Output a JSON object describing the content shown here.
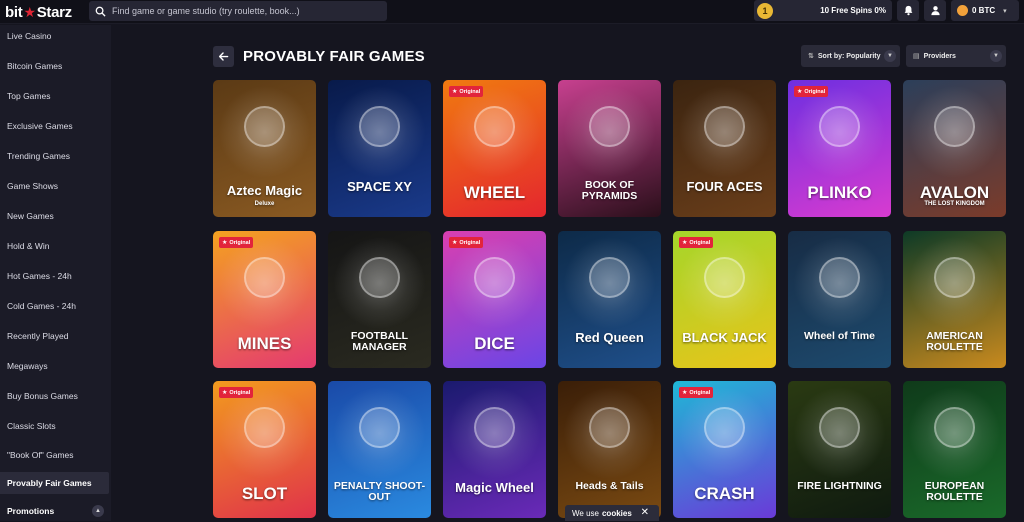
{
  "brand": {
    "logo_left": "bit",
    "logo_star": "★",
    "logo_right": "Starz"
  },
  "search": {
    "placeholder": "Find game or game studio (try roulette, book...)"
  },
  "header": {
    "free_spins_icon": "1",
    "free_spins": "10 Free Spins 0%",
    "balance": "0 BTC",
    "bell_icon": "bell-icon",
    "user_icon": "user-icon"
  },
  "sidebar": {
    "items": [
      {
        "label": "Live Casino"
      },
      {
        "label": "Bitcoin Games"
      },
      {
        "label": "Top Games"
      },
      {
        "label": "Exclusive Games"
      },
      {
        "label": "Trending Games"
      },
      {
        "label": "Game Shows"
      },
      {
        "label": "New Games"
      },
      {
        "label": "Hold & Win"
      },
      {
        "label": "Hot Games - 24h"
      },
      {
        "label": "Cold Games - 24h"
      },
      {
        "label": "Recently Played"
      },
      {
        "label": "Megaways"
      },
      {
        "label": "Buy Bonus Games"
      },
      {
        "label": "Classic Slots"
      },
      {
        "label": "\"Book Of\" Games"
      },
      {
        "label": "Provably Fair Games"
      }
    ],
    "active": "Provably Fair Games",
    "promotions": "Promotions"
  },
  "page": {
    "title": "PROVABLY FAIR GAMES",
    "sort_label": "Sort by: Popularity",
    "providers_label": "Providers"
  },
  "badge_label": "Original",
  "games": [
    {
      "title": "Aztec Magic",
      "subtitle": "Deluxe",
      "original": false,
      "bg": [
        "#5b3a15",
        "#8a5a22"
      ]
    },
    {
      "title": "SPACE XY",
      "original": false,
      "bg": [
        "#081a4a",
        "#1a3a8a"
      ]
    },
    {
      "title": "WHEEL",
      "original": true,
      "bg": [
        "#f07a10",
        "#e4262e"
      ]
    },
    {
      "title": "BOOK OF PYRAMIDS",
      "original": false,
      "bg": [
        "#c7408f",
        "#2a0f1a"
      ]
    },
    {
      "title": "FOUR ACES",
      "original": false,
      "bg": [
        "#3b2410",
        "#6a3e1a"
      ]
    },
    {
      "title": "PLINKO",
      "original": true,
      "bg": [
        "#6e2fe0",
        "#d83bd0"
      ]
    },
    {
      "title": "AVALON",
      "subtitle": "THE LOST KINGDOM",
      "original": false,
      "bg": [
        "#2c3f5a",
        "#7b3b2a"
      ]
    },
    {
      "title": "MINES",
      "original": true,
      "bg": [
        "#f4a220",
        "#e43a70"
      ]
    },
    {
      "title": "FOOTBALL MANAGER",
      "original": false,
      "bg": [
        "#151515",
        "#2a2a20"
      ]
    },
    {
      "title": "DICE",
      "original": true,
      "bg": [
        "#d93fb0",
        "#6b45e6"
      ]
    },
    {
      "title": "Red Queen",
      "original": false,
      "bg": [
        "#0d2a48",
        "#1f4f8a"
      ]
    },
    {
      "title": "BLACK JACK",
      "original": true,
      "bg": [
        "#a5d62a",
        "#e8c41a"
      ]
    },
    {
      "title": "Wheel of Time",
      "original": false,
      "bg": [
        "#172c45",
        "#1d4a6e"
      ]
    },
    {
      "title": "AMERICAN ROULETTE",
      "original": false,
      "bg": [
        "#0d3a26",
        "#c98a1e"
      ]
    },
    {
      "title": "SLOT",
      "original": true,
      "bg": [
        "#f29b1e",
        "#e0324a"
      ]
    },
    {
      "title": "PENALTY SHOOT-OUT",
      "original": false,
      "bg": [
        "#1a4aa8",
        "#2a8ae0"
      ]
    },
    {
      "title": "Magic Wheel",
      "original": false,
      "bg": [
        "#1a1a6e",
        "#6a2ab8"
      ]
    },
    {
      "title": "Heads & Tails",
      "original": false,
      "bg": [
        "#3a1e08",
        "#7a4a12"
      ]
    },
    {
      "title": "CRASH",
      "original": true,
      "bg": [
        "#1fb8d6",
        "#6a3ad8"
      ]
    },
    {
      "title": "FIRE LIGHTNING",
      "original": false,
      "bg": [
        "#2a3a12",
        "#0f1a10"
      ]
    },
    {
      "title": "EUROPEAN ROULETTE",
      "original": false,
      "bg": [
        "#0f3a1a",
        "#1a6a2a"
      ]
    }
  ],
  "cookie": {
    "text": "We use",
    "bold": "cookies",
    "close": "✕"
  }
}
